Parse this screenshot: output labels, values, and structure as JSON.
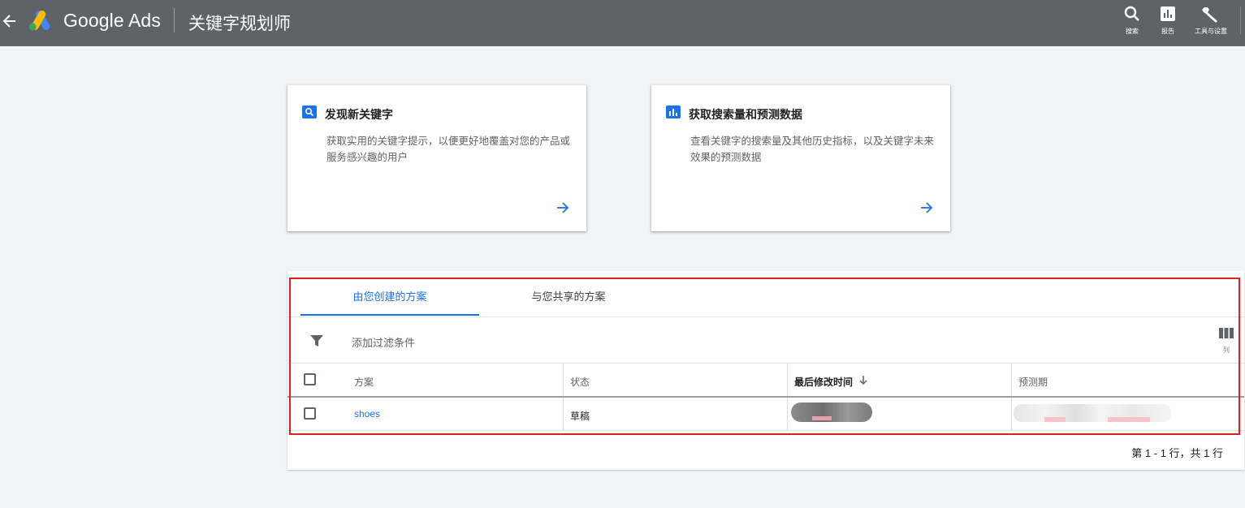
{
  "header": {
    "brand": "Google Ads",
    "page_title": "关键字规划师",
    "tools": [
      {
        "icon": "search-icon",
        "label": "搜索"
      },
      {
        "icon": "reports-icon",
        "label": "报告"
      },
      {
        "icon": "wrench-icon",
        "label": "工具与设置"
      }
    ]
  },
  "cards": [
    {
      "icon": "search-icon",
      "title": "发现新关键字",
      "description": "获取实用的关键字提示，以便更好地覆盖对您的产品或服务感兴趣的用户"
    },
    {
      "icon": "bar-chart-icon",
      "title": "获取搜索量和预测数据",
      "description": "查看关键字的搜索量及其他历史指标，以及关键字未来效果的预测数据"
    }
  ],
  "plans": {
    "tabs": [
      "由您创建的方案",
      "与您共享的方案"
    ],
    "active_tab": 0,
    "filter_label": "添加过滤条件",
    "columns_label": "列",
    "table": {
      "headers": [
        "方案",
        "状态",
        "最后修改时间",
        "预测期"
      ],
      "sorted_column": "最后修改时间",
      "sort_direction": "descending",
      "rows": [
        {
          "plan": "shoes",
          "status": "草稿"
        }
      ]
    },
    "pagination": "第 1 - 1 行，共 1 行"
  },
  "colors": {
    "topbar": "#5f6368",
    "accent": "#1a73e8",
    "highlight": "#e02020"
  }
}
